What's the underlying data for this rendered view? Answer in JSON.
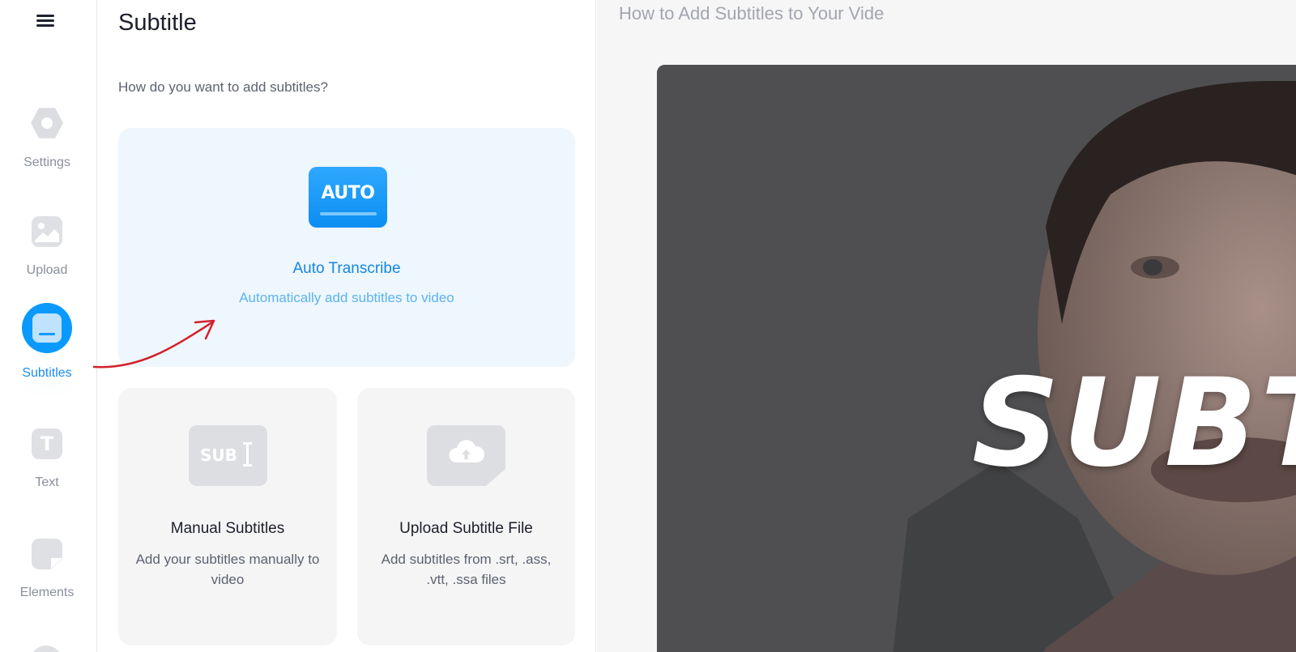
{
  "nav": {
    "menu_icon": "hamburger-icon",
    "items": [
      {
        "label": "Settings",
        "icon": "gear-icon"
      },
      {
        "label": "Upload",
        "icon": "image-icon"
      },
      {
        "label": "Subtitles",
        "icon": "subtitles-icon",
        "active": true
      },
      {
        "label": "Text",
        "icon": "text-icon"
      },
      {
        "label": "Elements",
        "icon": "sticker-icon"
      }
    ]
  },
  "panel": {
    "title": "Subtitle",
    "question": "How do you want to add subtitles?",
    "auto": {
      "badge": "AUTO",
      "title": "Auto Transcribe",
      "subtitle": "Automatically add subtitles to video"
    },
    "manual": {
      "badge": "SUB",
      "title": "Manual Subtitles",
      "subtitle": "Add your subtitles manually to video"
    },
    "upload": {
      "icon": "cloud-upload-icon",
      "title": "Upload Subtitle File",
      "subtitle": "Add subtitles from .srt, .ass, .vtt, .ssa files"
    }
  },
  "preview": {
    "video_title": "How to Add Subtitles to Your Vide",
    "overlay_text": "SUBTI"
  },
  "colors": {
    "accent": "#0a99ff",
    "accent_text": "#1487e0",
    "annotation_arrow": "#d4202a"
  }
}
